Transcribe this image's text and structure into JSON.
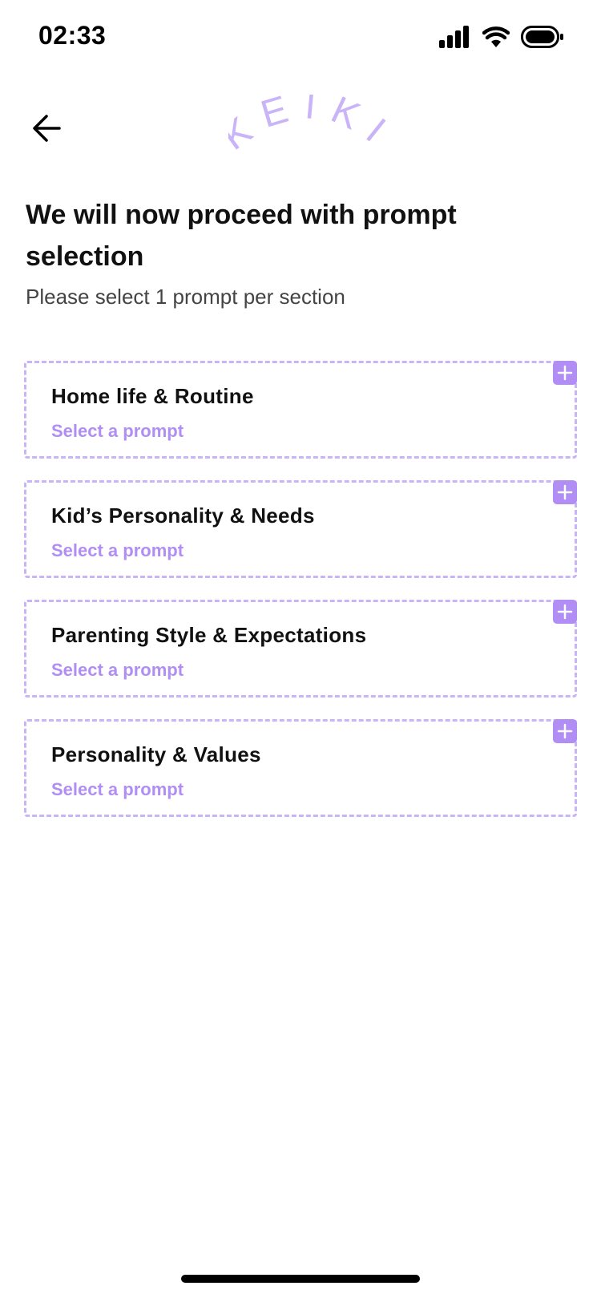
{
  "status_bar": {
    "time": "02:33",
    "icons": [
      "cellular-signal-icon",
      "wifi-icon",
      "battery-icon"
    ]
  },
  "header": {
    "back_icon": "arrow-left-icon",
    "logo_text": "KEIKI",
    "logo_color": "#c9b4f7"
  },
  "main": {
    "title": "We will now proceed with prompt selection",
    "subtitle": "Please select 1 prompt per section"
  },
  "sections": [
    {
      "title": "Home life & Routine",
      "action": "Select a prompt"
    },
    {
      "title": "Kid’s Personality & Needs",
      "action": "Select a prompt"
    },
    {
      "title": "Parenting Style & Expectations",
      "action": "Select a prompt"
    },
    {
      "title": "Personality & Values",
      "action": "Select a prompt"
    }
  ],
  "colors": {
    "accent": "#b18ef3",
    "border": "#c9b4f7",
    "text": "#111111",
    "subtext": "#444444"
  }
}
